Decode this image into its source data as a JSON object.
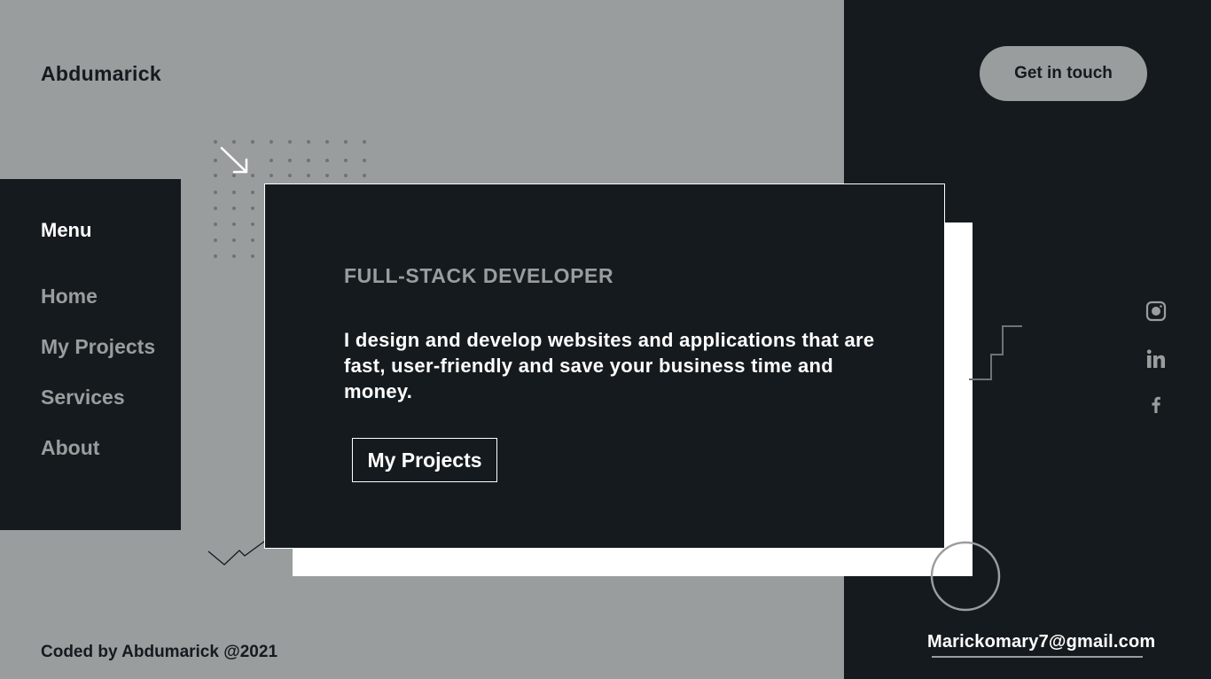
{
  "header": {
    "logo": "Abdumarick",
    "cta_label": "Get in touch"
  },
  "menu": {
    "title": "Menu",
    "items": [
      {
        "label": "Home"
      },
      {
        "label": "My Projects"
      },
      {
        "label": "Services"
      },
      {
        "label": "About"
      }
    ]
  },
  "hero": {
    "role": "FULL-STACK DEVELOPER",
    "description": "I design and develop websites and applications that are fast, user-friendly and save your business time and money.",
    "button_label": "My Projects"
  },
  "social": {
    "icons": [
      "instagram-icon",
      "linkedin-icon",
      "facebook-icon"
    ]
  },
  "contact": {
    "email": "Marickomary7@gmail.com"
  },
  "footer": {
    "credit": "Coded by Abdumarick @2021"
  },
  "colors": {
    "background": "#9a9d9e",
    "dark": "#151a1e",
    "white": "#ffffff"
  }
}
